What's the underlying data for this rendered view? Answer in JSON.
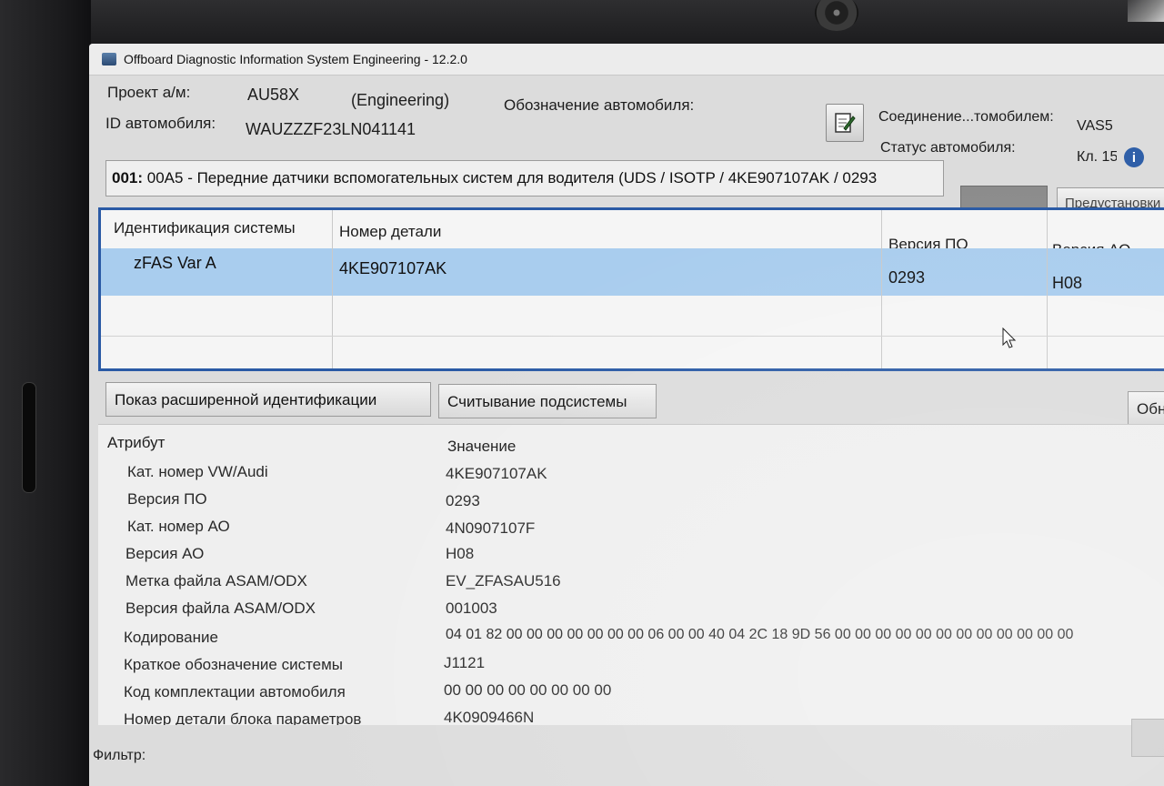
{
  "window": {
    "title": "Offboard Diagnostic Information System Engineering - 12.2.0"
  },
  "header": {
    "project_label": "Проект а/м:",
    "project_value": "AU58X",
    "mode": "(Engineering)",
    "designation_label": "Обозначение автомобиля:",
    "vin_label": "ID автомобиля:",
    "vin_value": "WAUZZZF23LN041141",
    "connection_label": "Соединение...томобилем:",
    "connection_value": "VAS5",
    "status_label": "Статус автомобиля:",
    "status_value": "Кл. 15"
  },
  "ecu": {
    "address": "001:",
    "description": "00A5 - Передние датчики вспомогательных систем для водителя  (UDS / ISOTP / 4KE907107AK / 0293"
  },
  "preset_button_label": "Предустановки",
  "grid": {
    "headers": [
      "Идентификация системы",
      "Номер детали",
      "Версия ПО",
      "Версия АО"
    ],
    "row": {
      "system": "zFAS Var A",
      "part": "4KE907107AK",
      "sw": "0293",
      "hw": "H08"
    }
  },
  "buttons": {
    "extended_id": "Показ расширенной идентификации",
    "subsystems": "Считывание подсистемы",
    "refresh": "Обновить"
  },
  "attributes": {
    "header_attr": "Атрибут",
    "header_value": "Значение",
    "rows": [
      {
        "name": "Кат. номер VW/Audi",
        "value": "4KE907107AK"
      },
      {
        "name": "Версия ПО",
        "value": "0293"
      },
      {
        "name": "Кат. номер АО",
        "value": "4N0907107F"
      },
      {
        "name": "Версия АО",
        "value": "H08"
      },
      {
        "name": "Метка файла ASAM/ODX",
        "value": "EV_ZFASAU516"
      },
      {
        "name": "Версия файла ASAM/ODX",
        "value": "001003"
      },
      {
        "name": "Кодирование",
        "value": "04 01 82 00 00 00 00 00 00 00 06 00 00 40 04 2C 18 9D 56 00 00 00 00 00 00 00 00 00 00 00 00"
      },
      {
        "name": "Краткое обозначение системы",
        "value": "J1121"
      },
      {
        "name": "Код комплектации автомобиля",
        "value": "00 00 00 00 00 00 00 00"
      },
      {
        "name": "Номер детали блока параметров",
        "value": "4K0909466N"
      }
    ]
  },
  "filter_label": "Фильтр:",
  "colors": {
    "selection": "#a9cdee",
    "grid_border": "#2a5aa5"
  },
  "icons": [
    "app-icon",
    "notebook-edit-icon",
    "info-icon",
    "mouse-cursor-icon"
  ]
}
